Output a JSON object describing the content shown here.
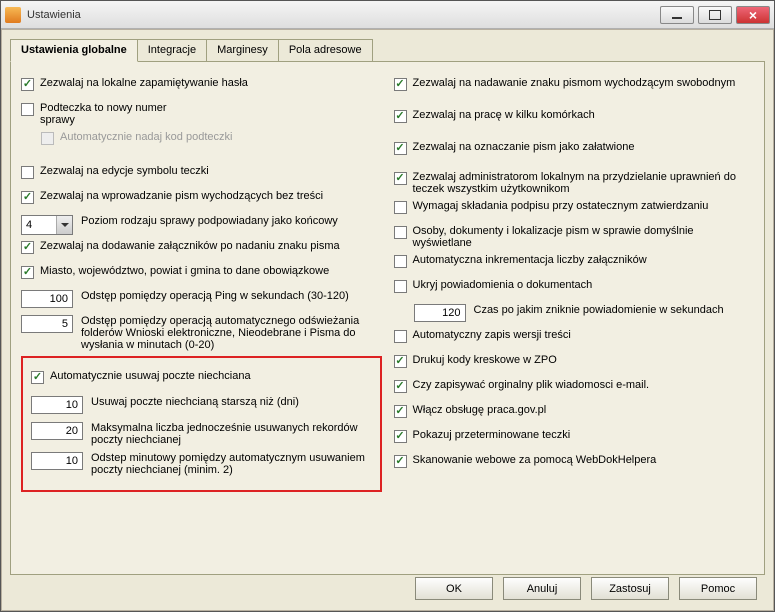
{
  "window": {
    "title": "Ustawienia"
  },
  "tabs": {
    "global": "Ustawienia globalne",
    "integrations": "Integracje",
    "margins": "Marginesy",
    "address": "Pola adresowe"
  },
  "left": {
    "allow_local_pw": "Zezwalaj na lokalne zapamiętywanie hasła",
    "podteczka": "Podteczka to nowy numer\nsprawy",
    "auto_kod": "Automatycznie nadaj kod podteczki",
    "allow_edit_symbol": "Zezwalaj na edycje symbolu teczki",
    "allow_outgoing_empty": "Zezwalaj na wprowadzanie pism wychodzących bez treści",
    "level_label": "Poziom rodzaju sprawy podpowiadany jako końcowy",
    "level_value": "4",
    "allow_attach_after_sign": "Zezwalaj na dodawanie załączników  po nadaniu znaku pisma",
    "city_required": "Miasto, województwo, powiat i gmina to dane obowiązkowe",
    "ping_value": "100",
    "ping_label": "Odstęp pomiędzy operacją Ping w sekundach (30-120)",
    "refresh_value": "5",
    "refresh_label": "Odstęp pomiędzy operacją automatycznego odświeżania folderów Wnioski elektroniczne, Nieodebrane i Pisma do wysłania w minutach (0-20)"
  },
  "junk": {
    "enable": "Automatycznie usuwaj poczte niechciana",
    "older_value": "10",
    "older_label": "Usuwaj poczte niechcianą starszą niż (dni)",
    "max_value": "20",
    "max_label": "Maksymalna liczba jednocześnie usuwanych rekordów poczty niechcianej",
    "interval_value": "10",
    "interval_label": "Odstep minutowy pomiędzy automatycznym usuwaniem poczty niechcianej (minim. 2)"
  },
  "right": {
    "allow_freeform_sign": "Zezwalaj na nadawanie znaku pismom wychodzącym swobodnym",
    "allow_multi_cells": "Zezwalaj na pracę w kilku komórkach",
    "allow_mark_done": "Zezwalaj na oznaczanie pism jako załatwione",
    "allow_admin_assign": "Zezwalaj administratorom lokalnym na przydzielanie uprawnień do teczek wszystkim użytkownikom",
    "require_final_sign": "Wymagaj składania podpisu przy ostatecznym zatwierdzaniu",
    "people_docs_default": "Osoby, dokumenty i lokalizacje pism w sprawie domyślnie wyświetlane",
    "auto_incr_attach": "Automatyczna inkrementacja liczby załączników",
    "hide_doc_notif": "Ukryj powiadomienia o dokumentach",
    "notif_timeout_value": "120",
    "notif_timeout_label": "Czas po jakim zniknie powiadomienie w sekundach",
    "auto_save_version": "Automatyczny zapis wersji treści",
    "print_barcodes": "Drukuj kody kreskowe w ZPO",
    "save_original_eml": "Czy zapisywać orginalny plik wiadomosci e-mail.",
    "enable_praca": "Włącz obsługę praca.gov.pl",
    "show_expired": "Pokazuj przeterminowane teczki",
    "web_scan": "Skanowanie webowe za pomocą WebDokHelpera"
  },
  "buttons": {
    "ok": "OK",
    "cancel": "Anuluj",
    "apply": "Zastosuj",
    "help": "Pomoc"
  }
}
